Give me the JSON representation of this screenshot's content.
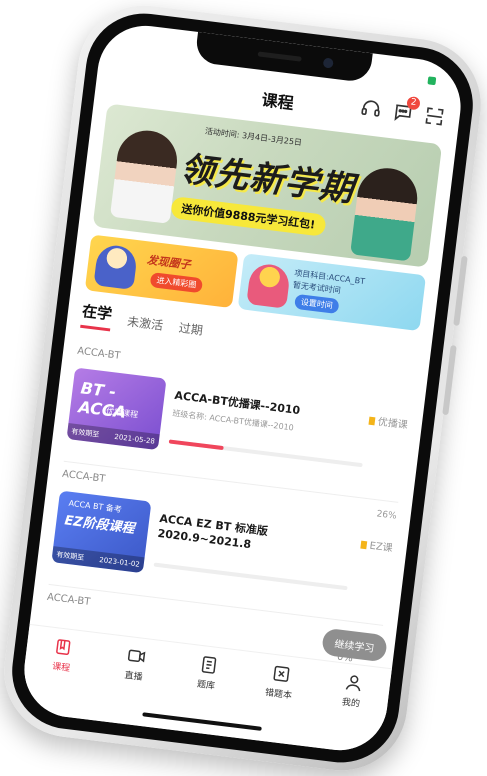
{
  "header": {
    "title": "课程"
  },
  "header_icons": [
    {
      "icon": "headset-icon"
    },
    {
      "icon": "message-icon",
      "badge": "2"
    },
    {
      "icon": "scan-icon"
    }
  ],
  "banner": {
    "period": "活动时间: 3月4日-3月25日",
    "headline": "领先新学期",
    "promo": "送你价值9888元学习红包!"
  },
  "sub_banners": [
    {
      "title": "发现圈子",
      "button": "进入精彩圈"
    },
    {
      "line1": "项目科目:ACCA_BT",
      "line2": "暂无考试时间",
      "button": "设置时间"
    }
  ],
  "tabs": [
    {
      "label": "在学",
      "active": true
    },
    {
      "label": "未激活",
      "active": false
    },
    {
      "label": "过期",
      "active": false
    }
  ],
  "courses": [
    {
      "section": "ACCA-BT",
      "thumb_big": "BT - ACCA",
      "thumb_small": "优播课程",
      "thumb_valid": "有效期至",
      "thumb_date": "2021-05-28",
      "name": "ACCA-BT优播课--2010",
      "class_name": "班级名称: ACCA-BT优播课--2010",
      "tag": "优播课",
      "progress": 0.28,
      "percent": ""
    },
    {
      "section": "ACCA-BT",
      "thumb_big": "EZ阶段课程",
      "thumb_small": "ACCA BT 备考",
      "thumb_valid": "有效期至",
      "thumb_date": "2023-01-02",
      "name": "ACCA EZ BT 标准版 2020.9~2021.8",
      "class_name": "",
      "tag": "EZ课",
      "progress": 0.0,
      "percent": "26%"
    },
    {
      "section": "ACCA-BT",
      "percent": "0%"
    }
  ],
  "floating_button": "继续学习",
  "nav": [
    {
      "label": "课程",
      "icon": "course-icon",
      "active": true
    },
    {
      "label": "直播",
      "icon": "video-icon",
      "active": false
    },
    {
      "label": "题库",
      "icon": "question-bank-icon",
      "active": false
    },
    {
      "label": "错题本",
      "icon": "wrong-book-icon",
      "active": false
    },
    {
      "label": "我的",
      "icon": "profile-icon",
      "active": false
    }
  ],
  "colors": {
    "accent": "#e8334a",
    "badge": "#f0483e",
    "tag": "#f4b41a"
  }
}
